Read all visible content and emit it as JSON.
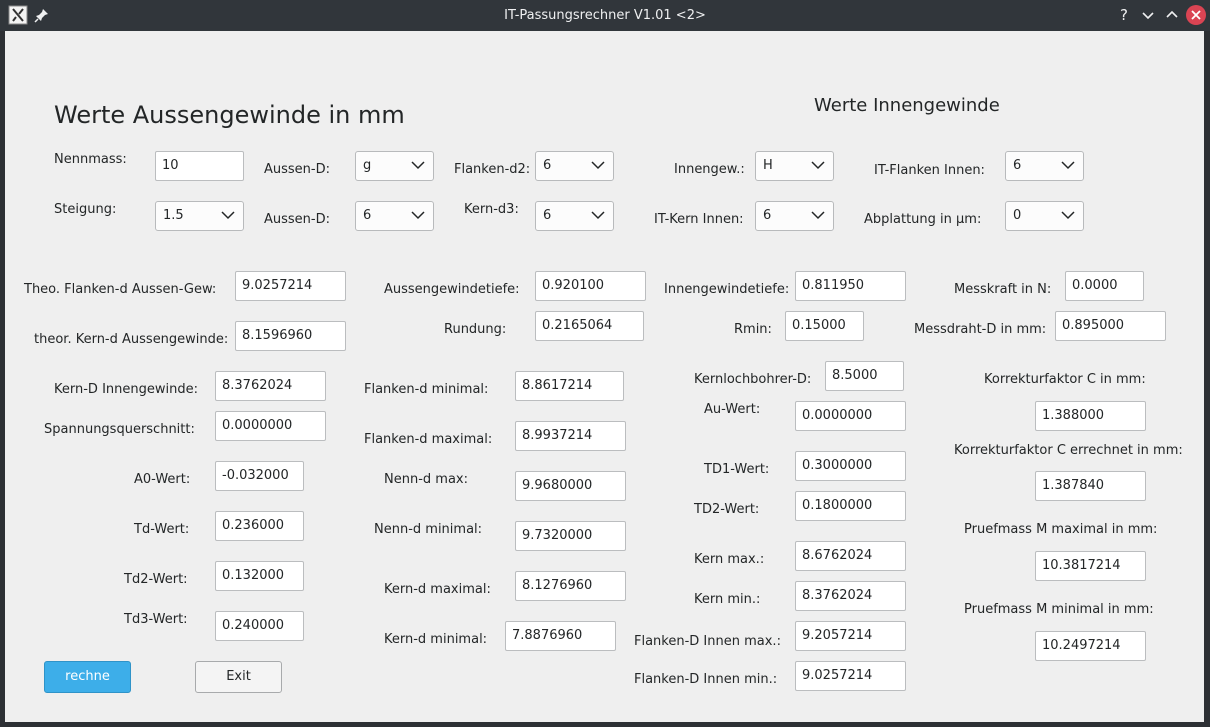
{
  "window": {
    "title": "IT-Passungsrechner V1.01 <2>"
  },
  "headings": {
    "outer": "Werte Aussengewinde in mm",
    "inner": "Werte Innengewinde"
  },
  "labels": {
    "nennmass": "Nennmass:",
    "steigung": "Steigung:",
    "aussen_d_1": "Aussen-D:",
    "aussen_d_2": "Aussen-D:",
    "flanken_d2": "Flanken-d2:",
    "kern_d3": "Kern-d3:",
    "innengew": "Innengew.:",
    "it_kern_innen": "IT-Kern Innen:",
    "it_flanken_innen": "IT-Flanken Innen:",
    "abplattung": "Abplattung in µm:",
    "theo_flanken": "Theo. Flanken-d Aussen-Gew:",
    "theor_kern": "theor. Kern-d Aussengewinde:",
    "kern_d_innengewinde": "Kern-D Innengewinde:",
    "spannungsquerschnitt": "Spannungsquerschnitt:",
    "a0": "A0-Wert:",
    "td": "Td-Wert:",
    "td2": "Td2-Wert:",
    "td3": "Td3-Wert:",
    "aussengewindetiefe": "Aussengewindetiefe:",
    "rundung": "Rundung:",
    "flanken_min": "Flanken-d minimal:",
    "flanken_max": "Flanken-d maximal:",
    "nenn_max": "Nenn-d max:",
    "nenn_min": "Nenn-d minimal:",
    "kern_max": "Kern-d maximal:",
    "kern_min": "Kern-d minimal:",
    "innengewindetiefe": "Innengewindetiefe:",
    "rmin": "Rmin:",
    "kernlochbohrer": "Kernlochbohrer-D:",
    "au": "Au-Wert:",
    "td1": "TD1-Wert:",
    "td2_inner": "TD2-Wert:",
    "kern_max_inner": "Kern max.:",
    "kern_min_inner": "Kern min.:",
    "flanken_innen_max": "Flanken-D Innen max.:",
    "flanken_innen_min": "Flanken-D Innen min.:",
    "messkraft": "Messkraft in N:",
    "messdraht": "Messdraht-D in mm:",
    "korrektur": "Korrekturfaktor C in mm:",
    "korrektur_err": "Korrekturfaktor C errechnet in mm:",
    "pruef_max": "Pruefmass M maximal in mm:",
    "pruef_min": "Pruefmass M minimal in mm:"
  },
  "selects": {
    "steigung": "1.5",
    "aussen_d_1": "g",
    "aussen_d_2": "6",
    "flanken_d2": "6",
    "kern_d3": "6",
    "innengew": "H",
    "it_kern_innen": "6",
    "it_flanken_innen": "6",
    "abplattung": "0"
  },
  "fields": {
    "nennmass": "10",
    "theo_flanken": "9.0257214",
    "theor_kern": "8.1596960",
    "kern_d_innengewinde": "8.3762024",
    "spannungsquerschnitt": "0.0000000",
    "a0": "-0.032000",
    "td": "0.236000",
    "td2": "0.132000",
    "td3": "0.240000",
    "aussengewindetiefe": "0.920100",
    "rundung": "0.2165064",
    "flanken_min": "8.8617214",
    "flanken_max": "8.9937214",
    "nenn_max": "9.9680000",
    "nenn_min": "9.7320000",
    "kern_max": "8.1276960",
    "kern_min": "7.8876960",
    "innengewindetiefe": "0.811950",
    "rmin": "0.15000",
    "kernlochbohrer": "8.5000",
    "au": "0.0000000",
    "td1": "0.3000000",
    "td2_inner": "0.1800000",
    "kern_max_inner": "8.6762024",
    "kern_min_inner": "8.3762024",
    "flanken_innen_max": "9.2057214",
    "flanken_innen_min": "9.0257214",
    "messkraft": "0.0000",
    "messdraht": "0.895000",
    "korrektur": "1.388000",
    "korrektur_err": "1.387840",
    "pruef_max": "10.3817214",
    "pruef_min": "10.2497214"
  },
  "buttons": {
    "rechne": "rechne",
    "exit": "Exit"
  },
  "colors": {
    "accent": "#3daee9",
    "close": "#da4453",
    "titlebar": "#31363b"
  }
}
